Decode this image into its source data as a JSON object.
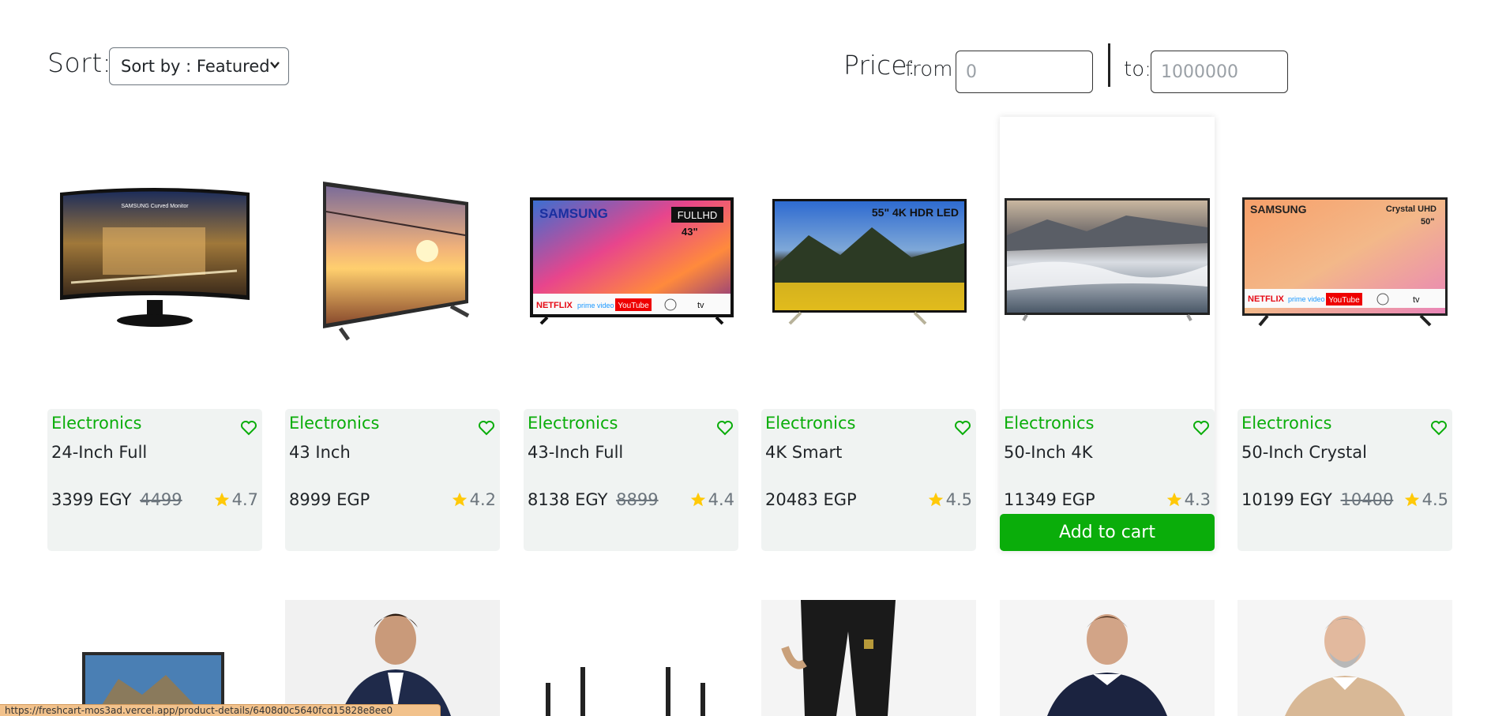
{
  "toolbar": {
    "sort_label": "Sort:",
    "sort_selected": "Sort by : Featured",
    "price_label": "Price:",
    "from_label": "from:",
    "from_placeholder": "0",
    "to_label": "to:",
    "to_placeholder": "1000000"
  },
  "products": [
    {
      "category": "Electronics",
      "title": "24-Inch Full",
      "price": "3399 EGY",
      "old_price": "4499",
      "rating": "4.7"
    },
    {
      "category": "Electronics",
      "title": "43 Inch",
      "price": "8999 EGP",
      "old_price": "",
      "rating": "4.2"
    },
    {
      "category": "Electronics",
      "title": "43-Inch Full",
      "price": "8138 EGY",
      "old_price": "8899",
      "rating": "4.4"
    },
    {
      "category": "Electronics",
      "title": "4K Smart",
      "price": "20483 EGP",
      "old_price": "",
      "rating": "4.5"
    },
    {
      "category": "Electronics",
      "title": "50-Inch 4K",
      "price": "11349 EGP",
      "old_price": "",
      "rating": "4.3",
      "add_to_cart": "Add to cart"
    },
    {
      "category": "Electronics",
      "title": "50-Inch Crystal",
      "price": "10199 EGY",
      "old_price": "10400",
      "rating": "4.5"
    }
  ],
  "tv_overlays": {
    "monitor": "SAMSUNG Curved Monitor",
    "samsung": "SAMSUNG",
    "fullhd": "FULLHD",
    "size_43": "43\"",
    "hdr": "55\" 4K HDR LED",
    "crystal": "Crystal UHD",
    "size_50": "50\"",
    "apps": [
      "NETFLIX",
      "prime video",
      "YouTube",
      "",
      "tv"
    ]
  },
  "status_url": "https://freshcart-mos3ad.vercel.app/product-details/6408d0c5640fcd15828e8ee0",
  "colors": {
    "accent": "#0aad0a",
    "star": "#ffc908",
    "card_bg": "#f0f3f2"
  }
}
